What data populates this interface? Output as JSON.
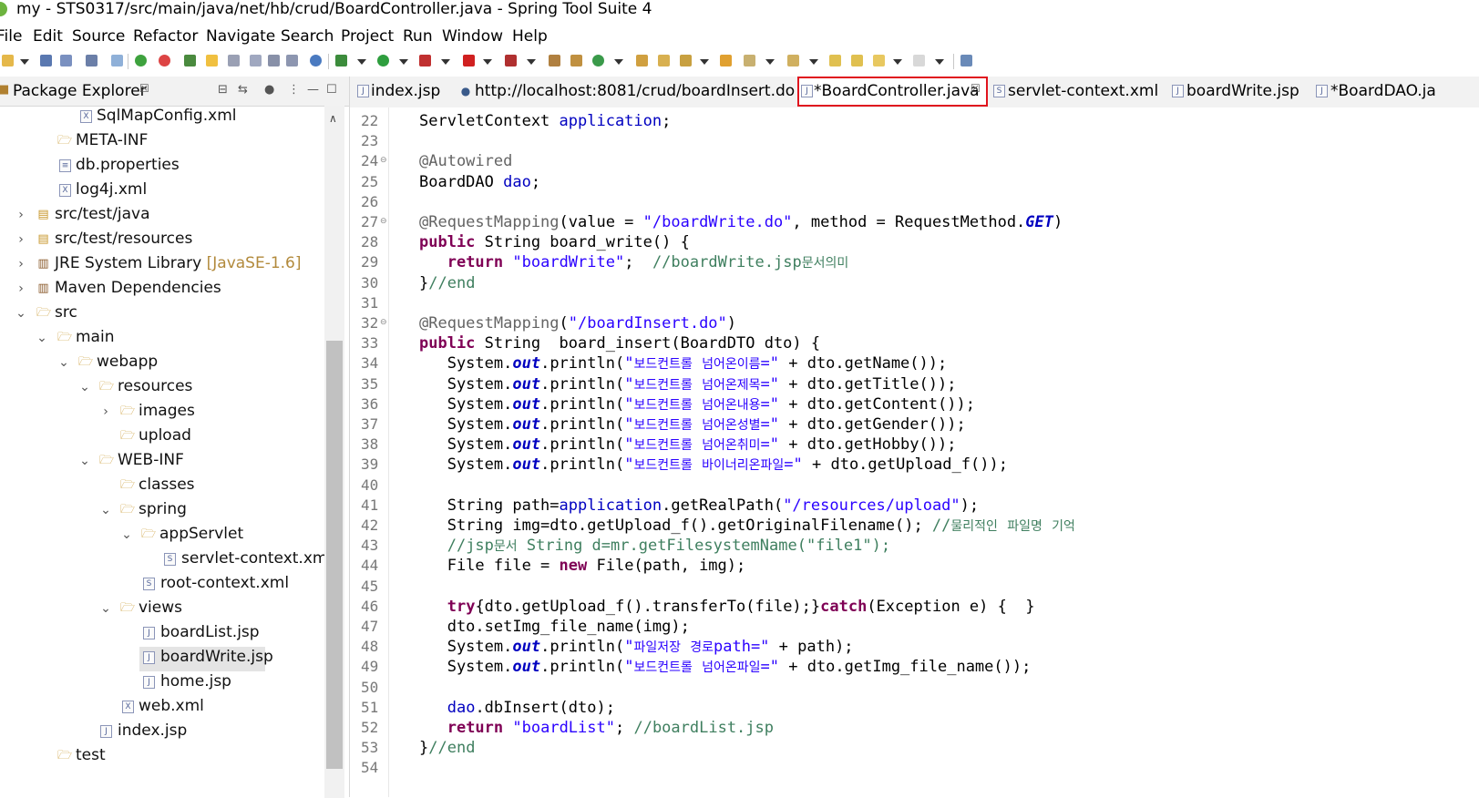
{
  "window": {
    "title": "my - STS0317/src/main/java/net/hb/crud/BoardController.java - Spring Tool Suite 4"
  },
  "menu": [
    "File",
    "Edit",
    "Source",
    "Refactor",
    "Navigate",
    "Search",
    "Project",
    "Run",
    "Window",
    "Help"
  ],
  "package_explorer": {
    "title": "Package Explorer",
    "tree": [
      {
        "label": "SqlMapConfig.xml",
        "icon": "xml-file-icon"
      },
      {
        "label": "META-INF",
        "icon": "folder-icon"
      },
      {
        "label": "db.properties",
        "icon": "properties-file-icon"
      },
      {
        "label": "log4j.xml",
        "icon": "xml-file-icon"
      },
      {
        "label": "src/test/java",
        "icon": "source-folder-icon"
      },
      {
        "label": "src/test/resources",
        "icon": "source-folder-icon"
      },
      {
        "label": "JRE System Library",
        "suffix": "[JavaSE-1.6]",
        "icon": "library-icon"
      },
      {
        "label": "Maven Dependencies",
        "icon": "library-icon"
      },
      {
        "label": "src",
        "icon": "package-folder-icon"
      },
      {
        "label": "main",
        "icon": "package-folder-icon"
      },
      {
        "label": "webapp",
        "icon": "package-folder-icon"
      },
      {
        "label": "resources",
        "icon": "folder-icon"
      },
      {
        "label": "images",
        "icon": "folder-icon"
      },
      {
        "label": "upload",
        "icon": "folder-icon"
      },
      {
        "label": "WEB-INF",
        "icon": "package-folder-icon"
      },
      {
        "label": "classes",
        "icon": "folder-icon"
      },
      {
        "label": "spring",
        "icon": "folder-icon"
      },
      {
        "label": "appServlet",
        "icon": "folder-icon"
      },
      {
        "label": "servlet-context.xml",
        "icon": "spring-xml-icon"
      },
      {
        "label": "root-context.xml",
        "icon": "spring-xml-icon"
      },
      {
        "label": "views",
        "icon": "folder-icon"
      },
      {
        "label": "boardList.jsp",
        "icon": "jsp-file-icon"
      },
      {
        "label": "boardWrite.jsp",
        "icon": "jsp-file-icon"
      },
      {
        "label": "home.jsp",
        "icon": "jsp-file-icon"
      },
      {
        "label": "web.xml",
        "icon": "xml-file-icon"
      },
      {
        "label": "index.jsp",
        "icon": "jsp-file-icon"
      },
      {
        "label": "test",
        "icon": "folder-icon"
      }
    ]
  },
  "editor_tabs": [
    {
      "label": "index.jsp",
      "icon": "jsp-file-icon"
    },
    {
      "label": "http://localhost:8081/crud/boardInsert.do",
      "icon": "browser-icon"
    },
    {
      "label": "*BoardController.java",
      "icon": "java-file-icon",
      "active": true
    },
    {
      "label": "servlet-context.xml",
      "icon": "spring-xml-icon"
    },
    {
      "label": "boardWrite.jsp",
      "icon": "jsp-file-icon"
    },
    {
      "label": "*BoardDAO.ja",
      "icon": "java-file-icon"
    }
  ],
  "code": {
    "line_numbers": [
      "22",
      "23",
      "24",
      "25",
      "26",
      "27",
      "28",
      "29",
      "30",
      "31",
      "32",
      "33",
      "34",
      "35",
      "36",
      "37",
      "38",
      "39",
      "40",
      "41",
      "42",
      "43",
      "44",
      "45",
      "46",
      "47",
      "48",
      "49",
      "50",
      "51",
      "52",
      "53",
      "54"
    ],
    "lines": [
      "ServletContext application;",
      "",
      "@Autowired",
      "BoardDAO dao;",
      "",
      "@RequestMapping(value = \"/boardWrite.do\", method = RequestMethod.GET)",
      "public String board_write() {",
      "   return \"boardWrite\";  //boardWrite.jsp문서의미",
      "}//end",
      "",
      "@RequestMapping(\"/boardInsert.do\")",
      "public String  board_insert(BoardDTO dto) {",
      "   System.out.println(\"보드컨트롤 넘어온이름=\" + dto.getName());",
      "   System.out.println(\"보드컨트롤 넘어온제목=\" + dto.getTitle());",
      "   System.out.println(\"보드컨트롤 넘어온내용=\" + dto.getContent());",
      "   System.out.println(\"보드컨트롤 넘어온성별=\" + dto.getGender());",
      "   System.out.println(\"보드컨트롤 넘어온취미=\" + dto.getHobby());",
      "   System.out.println(\"보드컨트롤 바이너리온파일=\" + dto.getUpload_f());",
      "",
      "   String path=application.getRealPath(\"/resources/upload\");",
      "   String img=dto.getUpload_f().getOriginalFilename(); //물리적인 파일명 기억",
      "   //jsp문서 String d=mr.getFilesystemName(\"file1\");",
      "   File file = new File(path, img);",
      "",
      "   try{dto.getUpload_f().transferTo(file);}catch(Exception e) {  }",
      "   dto.setImg_file_name(img);",
      "   System.out.println(\"파일저장 경로path=\" + path);",
      "   System.out.println(\"보드컨트롤 넘어온파일=\" + dto.getImg_file_name());",
      "",
      "   dao.dbInsert(dto);",
      "   return \"boardList\"; //boardList.jsp",
      "}//end",
      ""
    ]
  }
}
